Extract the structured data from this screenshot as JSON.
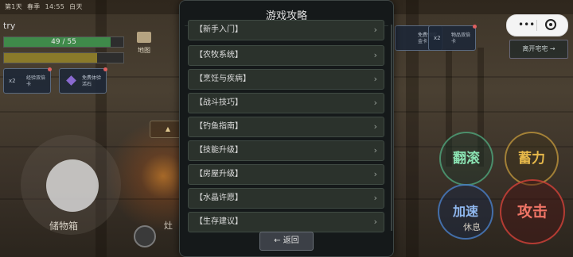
{
  "hud": {
    "day": "第1天",
    "season": "春季",
    "time": "14:55",
    "period": "白天",
    "player_name": "try",
    "hp_text": "49 / 55",
    "hp_fraction": 0.89,
    "stamina_fraction": 0.78,
    "map_label": "地图",
    "storage_label": "储物箱",
    "rest_label": "休息",
    "leave_label": "离开宅宅 →",
    "behind_text": "灶"
  },
  "cards": [
    {
      "x2": "x2",
      "text": "经验双倍卡"
    },
    {
      "x2": "",
      "text": "免费体验活石"
    },
    {
      "x2": "",
      "text": "免费领取金卡"
    },
    {
      "x2": "x2",
      "text": "物品双倍卡"
    }
  ],
  "actions": {
    "roll": "翻滚",
    "charge": "蓄力",
    "speed": "加速",
    "attack": "攻击"
  },
  "capsule": {
    "more": "•••"
  },
  "modal": {
    "title": "游戏攻略",
    "back_label": "← 返回",
    "items": [
      {
        "label": "【新手入门】",
        "arrow": "›"
      },
      {
        "label": "【农牧系统】",
        "arrow": "›"
      },
      {
        "label": "【烹饪与疾病】",
        "arrow": "›"
      },
      {
        "label": "【战斗技巧】",
        "arrow": "›"
      },
      {
        "label": "【钓鱼指南】",
        "arrow": "›"
      },
      {
        "label": "【技能升级】",
        "arrow": "›"
      },
      {
        "label": "【房屋升级】",
        "arrow": "›"
      },
      {
        "label": "【水晶许愿】",
        "arrow": "›"
      },
      {
        "label": "【生存建议】",
        "arrow": "›"
      }
    ]
  },
  "colors": {
    "modal_bg": "#15191a",
    "item_bg": "#2b322c",
    "hp": "#3f8a4a",
    "roll": "#8ae2b2",
    "charge": "#e6b84a",
    "speed": "#8fb7ee",
    "attack": "#ee7466"
  }
}
